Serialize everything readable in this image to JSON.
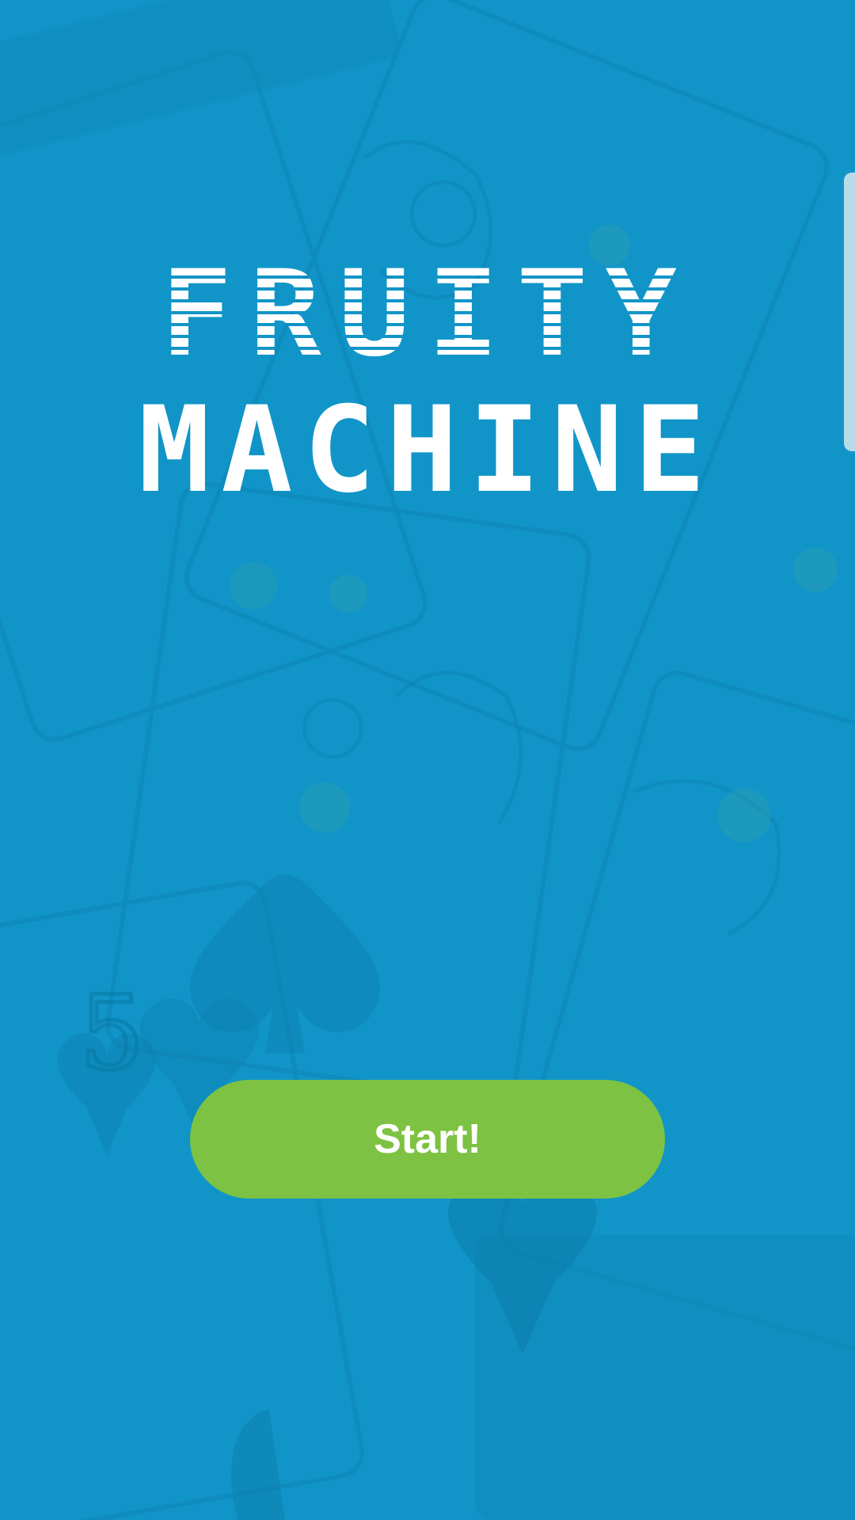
{
  "title": {
    "line1": "FRUITY",
    "line2": "MACHINE"
  },
  "start_button": {
    "label": "Start!"
  },
  "background": {
    "description_icon": "playing-cards-background",
    "card_rank": "5"
  },
  "colors": {
    "background": "#1195c8",
    "button": "#7dc242",
    "text": "#ffffff"
  }
}
